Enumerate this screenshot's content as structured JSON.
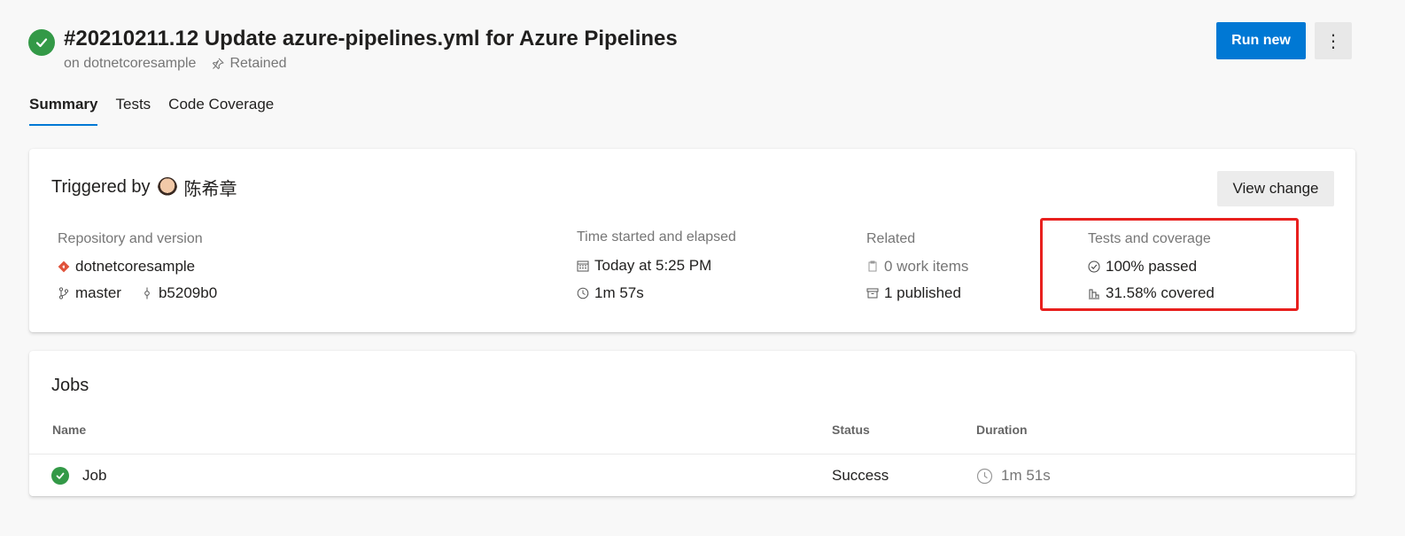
{
  "header": {
    "title": "#20210211.12 Update azure-pipelines.yml for Azure Pipelines",
    "subtitle_repo": "on dotnetcoresample",
    "subtitle_retained": "Retained",
    "run_new_label": "Run new",
    "more_label": "⋮"
  },
  "tabs": [
    {
      "label": "Summary",
      "active": true
    },
    {
      "label": "Tests",
      "active": false
    },
    {
      "label": "Code Coverage",
      "active": false
    }
  ],
  "summary": {
    "triggered_by_label": "Triggered by",
    "user_name": "陈希章",
    "view_change_label": "View change",
    "repository": {
      "label": "Repository and version",
      "repo_name": "dotnetcoresample",
      "branch": "master",
      "commit": "b5209b0"
    },
    "time": {
      "label": "Time started and elapsed",
      "started": "Today at 5:25 PM",
      "elapsed": "1m 57s"
    },
    "related": {
      "label": "Related",
      "work_items": "0 work items",
      "published": "1 published"
    },
    "tests": {
      "label": "Tests and coverage",
      "passed": "100% passed",
      "covered": "31.58% covered"
    }
  },
  "jobs": {
    "title": "Jobs",
    "columns": {
      "name": "Name",
      "status": "Status",
      "duration": "Duration"
    },
    "rows": [
      {
        "name": "Job",
        "status": "Success",
        "duration": "1m 51s"
      }
    ]
  },
  "colors": {
    "accent": "#0078d4",
    "success": "#339947",
    "highlight": "#e8201e",
    "repo_icon": "#e0533b"
  },
  "icons": {
    "status": "check-circle-icon",
    "retained": "pin-icon",
    "repo": "git-repo-icon",
    "branch": "branch-icon",
    "commit": "commit-icon",
    "calendar": "calendar-icon",
    "clock": "clock-icon",
    "work_items": "work-item-icon",
    "artifact": "artifact-icon",
    "test": "check-circle-outline-icon",
    "coverage": "coverage-icon"
  }
}
